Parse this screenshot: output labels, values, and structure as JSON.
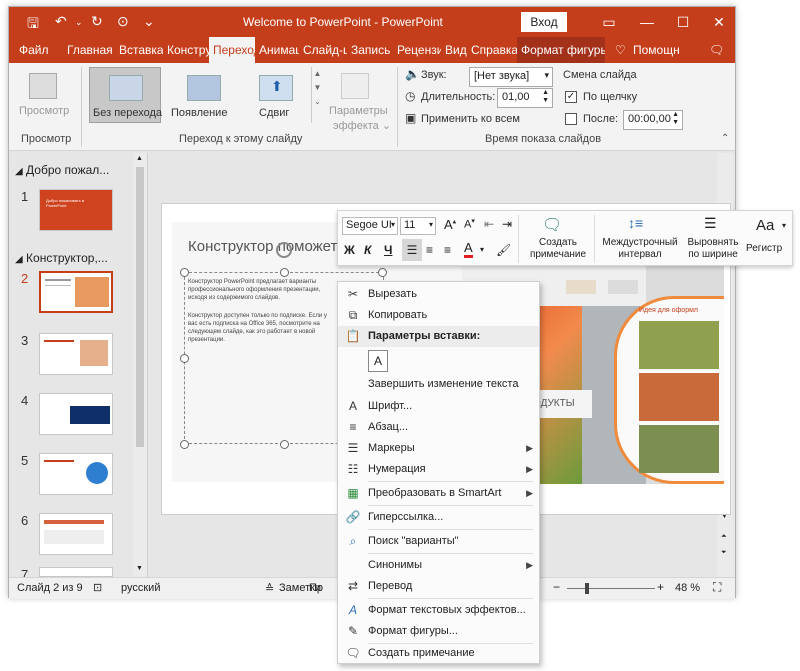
{
  "window": {
    "title": "Welcome to PowerPoint  -  PowerPoint",
    "login": "Вход",
    "min": "—",
    "max": "☐",
    "close": "✕"
  },
  "tabs": [
    "Файл",
    "Главная",
    "Вставка",
    "Констру",
    "Переход",
    "Анимац",
    "Слайд-ш",
    "Запись",
    "Рецензи",
    "Вид",
    "Справка",
    "Формат фигуры",
    "Помощн"
  ],
  "ribbon": {
    "preview_btn": "Просмотр",
    "preview_group": "Просмотр",
    "transitions": [
      "Без перехода",
      "Появление",
      "Сдвиг"
    ],
    "effect_params": [
      "Параметры",
      "эффекта ⌄"
    ],
    "transition_group": "Переход к этому слайду",
    "sound_label": "Звук:",
    "sound_value": "[Нет звука]",
    "duration_label": "Длительность:",
    "duration_value": "01,00",
    "apply_all": "Применить ко всем",
    "advance_title": "Смена слайда",
    "on_click": "По щелчку",
    "after": "После:",
    "after_value": "00:00,00",
    "timing_group": "Время показа слайдов"
  },
  "slides_pane": {
    "section1": "Добро пожал...",
    "section2": "Конструктор,...",
    "numbers": [
      "1",
      "2",
      "3",
      "4",
      "5",
      "6",
      "7"
    ],
    "thumb1_text": "Добро пожаловать в PowerPoint"
  },
  "slide": {
    "title": "Конструктор поможет",
    "body1": "Конструктор PowerPoint предлагает варианты профессионального оформления презентации, исходя из содержимого слайдов.",
    "body2": "Конструктор доступен только по подписке. Если у вас есть подписка на Office 365, посмотрите на следующем слайде, как это работает в новой презентации.",
    "idea_text": "Идея для оформл",
    "produce_label": "ПРОДУКТЫ"
  },
  "mini_toolbar": {
    "font_name": "Segoe UI",
    "font_size": "11",
    "bold": "Ж",
    "italic": "К",
    "underline": "Ч",
    "add_comment": [
      "Создать",
      "примечание"
    ],
    "line_spacing": [
      "Междустрочный",
      "интервал"
    ],
    "justify": [
      "Выровнять",
      "по ширине"
    ],
    "case": "Регистр",
    "case_icon": "Aa"
  },
  "context_menu": {
    "items": [
      {
        "label": "Вырезать",
        "icon": "scissors-icon",
        "glyph": "✂"
      },
      {
        "label": "Копировать",
        "icon": "copy-icon",
        "glyph": "⧉"
      },
      {
        "label": "Параметры вставки:",
        "icon": "paste-icon",
        "glyph": "📋"
      },
      {
        "label": "Завершить изменение текста",
        "icon": "",
        "glyph": ""
      },
      {
        "label": "Шрифт...",
        "icon": "font-icon",
        "glyph": "A"
      },
      {
        "label": "Абзац...",
        "icon": "paragraph-icon",
        "glyph": "≡"
      },
      {
        "label": "Маркеры",
        "icon": "bullets-icon",
        "glyph": "☰"
      },
      {
        "label": "Нумерация",
        "icon": "numbering-icon",
        "glyph": "☷"
      },
      {
        "label": "Преобразовать в SmartArt",
        "icon": "smartart-icon",
        "glyph": "▦"
      },
      {
        "label": "Гиперссылка...",
        "icon": "link-icon",
        "glyph": "🔗"
      },
      {
        "label": "Поиск \"варианты\"",
        "icon": "search-icon",
        "glyph": "⌕"
      },
      {
        "label": "Синонимы",
        "icon": "",
        "glyph": ""
      },
      {
        "label": "Перевод",
        "icon": "translate-icon",
        "glyph": "⇄"
      },
      {
        "label": "Формат текстовых эффектов...",
        "icon": "text-effects-icon",
        "glyph": "A"
      },
      {
        "label": "Формат фигуры...",
        "icon": "format-shape-icon",
        "glyph": "✎"
      },
      {
        "label": "Создать примечание",
        "icon": "comment-icon",
        "glyph": "💬"
      }
    ]
  },
  "status": {
    "slide_info": "Слайд 2 из 9",
    "language": "русский",
    "notes": "Заметки",
    "comments": "Пр",
    "zoom": "48 %",
    "zoom_minus": "−",
    "zoom_plus": "+"
  }
}
